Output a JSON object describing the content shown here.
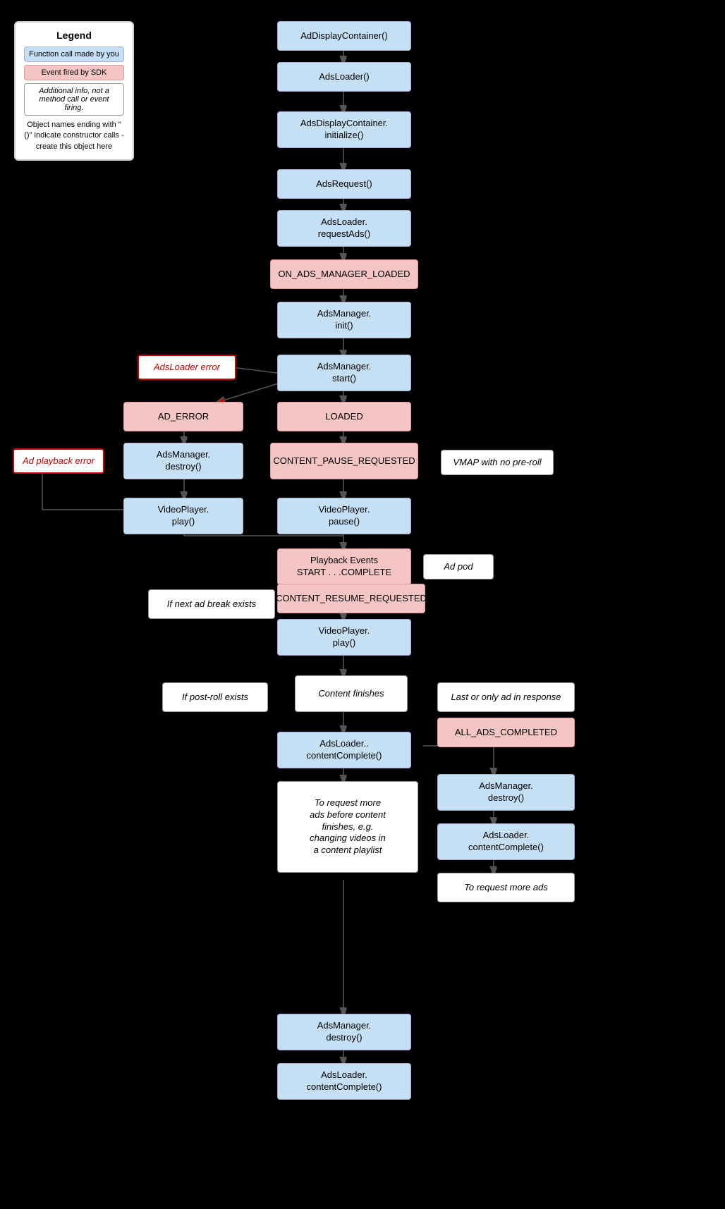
{
  "legend": {
    "title": "Legend",
    "item1": "Function call made by you",
    "item2": "Event fired by SDK",
    "item3": "Additional info, not a method call or event firing.",
    "footnote": "Object names ending with \"()\" indicate constructor calls - create this object here"
  },
  "nodes": {
    "adDisplayContainer": "AdDisplayContainer()",
    "adsLoader": "AdsLoader()",
    "adsDisplayContainerInit": "AdsDisplayContainer.\ninitialize()",
    "adsRequest": "AdsRequest()",
    "adsLoaderRequestAds": "AdsLoader.\nrequestAds()",
    "onAdsManagerLoaded": "ON_ADS_MANAGER_LOADED",
    "adsManagerInit": "AdsManager.\ninit()",
    "adsManagerStart": "AdsManager.\nstart()",
    "adsLoaderError": "AdsLoader error",
    "adError": "AD_ERROR",
    "loaded": "LOADED",
    "adsManagerDestroy": "AdsManager.\ndestroy()",
    "contentPauseRequested": "CONTENT_PAUSE_REQUESTED",
    "vmapNoPre": "VMAP with no pre-roll",
    "videoPlayerPlay": "VideoPlayer.\nplay()",
    "videoPlayerPause": "VideoPlayer.\npause()",
    "adPlaybackError": "Ad playback error",
    "playbackEvents": "Playback Events\nSTART . . .COMPLETE",
    "adPod": "Ad pod",
    "contentResumeRequested": "CONTENT_RESUME_REQUESTED",
    "ifNextAdBreak": "If next ad break exists",
    "videoPlayerPlay2": "VideoPlayer.\nplay()",
    "contentFinishes": "Content finishes",
    "ifPostRoll": "If post-roll exists",
    "lastOrOnly": "Last or only ad in response",
    "allAdsCompleted": "ALL_ADS_COMPLETED",
    "adsLoaderContentComplete": "AdsLoader..\ncontentComplete()",
    "adsManagerDestroy2": "AdsManager.\ndestroy()",
    "adsLoaderContentComplete2": "AdsLoader.\ncontentComplete()",
    "toRequestMoreAds": "To request more ads",
    "toRequestMoreAdsBefore": "To request more\nads before content\nfinishes, e.g.\nchanging videos in\na content playlist",
    "adsManagerDestroy3": "AdsManager.\ndestroy()",
    "adsLoaderContentComplete3": "AdsLoader.\ncontentComplete()"
  }
}
